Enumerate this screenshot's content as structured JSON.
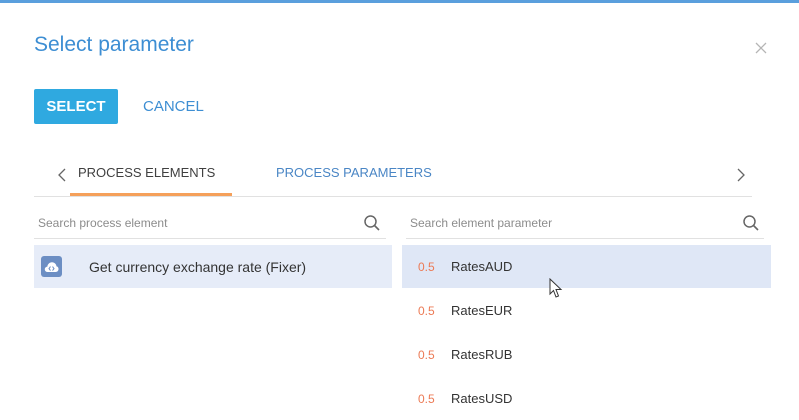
{
  "dialog": {
    "title": "Select parameter",
    "select_label": "SELECT",
    "cancel_label": "CANCEL"
  },
  "tabs": [
    {
      "label": "PROCESS ELEMENTS",
      "active": true
    },
    {
      "label": "PROCESS PARAMETERS",
      "active": false
    }
  ],
  "left_search": {
    "placeholder": "Search process element"
  },
  "right_search": {
    "placeholder": "Search element parameter"
  },
  "elements": [
    {
      "label": "Get currency exchange rate (Fixer)",
      "icon": "cloud-code-icon",
      "selected": true
    }
  ],
  "parameters": [
    {
      "type": "0.5",
      "name": "RatesAUD",
      "selected": true
    },
    {
      "type": "0.5",
      "name": "RatesEUR",
      "selected": false
    },
    {
      "type": "0.5",
      "name": "RatesRUB",
      "selected": false
    },
    {
      "type": "0.5",
      "name": "RatesUSD",
      "selected": false
    }
  ],
  "colors": {
    "accent": "#2fa9e0",
    "title": "#3d8ed3",
    "tab_underline": "#f5a05a",
    "type_number": "#ec7a55",
    "selection": "#e6ecf8"
  }
}
